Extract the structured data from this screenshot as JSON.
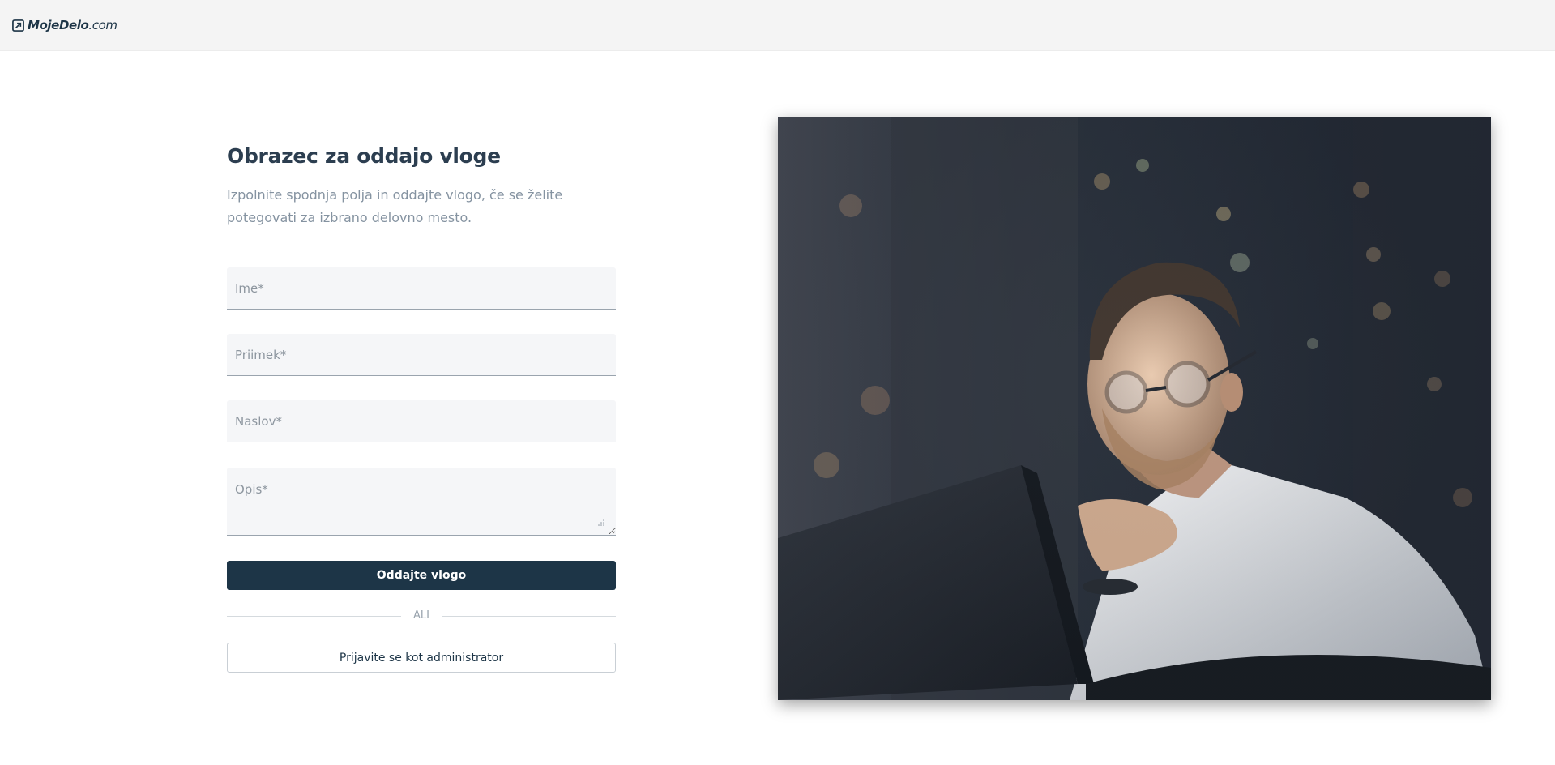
{
  "header": {
    "logo_text": "MojeDelo",
    "logo_suffix": ".com"
  },
  "form": {
    "title": "Obrazec za oddajo vloge",
    "subtitle": "Izpolnite spodnja polja in oddajte vlogo, če se želite potegovati za izbrano delovno mesto.",
    "fields": {
      "first_name": {
        "placeholder": "Ime*",
        "value": ""
      },
      "last_name": {
        "placeholder": "Priimek*",
        "value": ""
      },
      "title": {
        "placeholder": "Naslov*",
        "value": ""
      },
      "description": {
        "placeholder": "Opis*",
        "value": ""
      }
    },
    "submit_label": "Oddajte vlogo",
    "divider_label": "ALI",
    "admin_login_label": "Prijavite se kot administrator"
  },
  "hero": {
    "image": "man-with-glasses-at-laptop-photo"
  },
  "colors": {
    "primary": "#1d3547",
    "field_bg": "#f5f6f8",
    "topbar_bg": "#f4f4f4",
    "subtitle": "#8593a1"
  }
}
